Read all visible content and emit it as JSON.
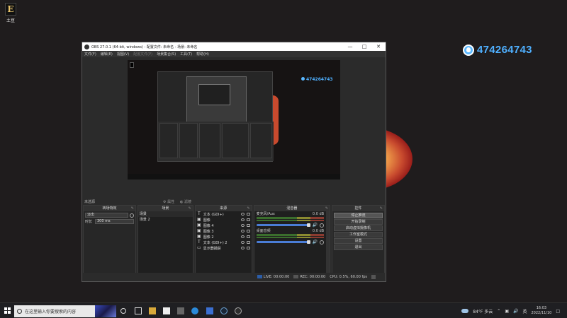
{
  "desktop": {
    "icon_label": "土豆",
    "qq_number": "474264743"
  },
  "obs": {
    "title": "OBS 27.0.1 (64-bit, windows) - 配置文件: 未命名 - 场景: 未命名",
    "menu": [
      "文件(F)",
      "编辑(E)",
      "视图(V)",
      "配置文件(P)",
      "场景集合(S)",
      "工具(T)",
      "帮助(H)"
    ],
    "canvas_qq": "474264743",
    "status_source": "未选源",
    "tools": [
      "属性",
      "滤镜"
    ],
    "docks": {
      "transition": {
        "title": "转场特效",
        "selected": "淡出",
        "duration_label": "时长",
        "duration_value": "300 ms"
      },
      "scenes": {
        "title": "场景",
        "items": [
          "场景",
          "场景 2"
        ]
      },
      "sources": {
        "title": "来源",
        "items": [
          {
            "icon": "text-icon",
            "name": "文本 (GDI+)"
          },
          {
            "icon": "image-icon",
            "name": "图像"
          },
          {
            "icon": "image-icon",
            "name": "图像 4"
          },
          {
            "icon": "image-icon",
            "name": "图像 3"
          },
          {
            "icon": "image-icon",
            "name": "图像 2"
          },
          {
            "icon": "text-icon",
            "name": "文本 (GDI+) 2"
          },
          {
            "icon": "monitor-icon",
            "name": "显示器捕获"
          }
        ]
      },
      "mixer": {
        "title": "混音器",
        "channels": [
          {
            "name": "麦克风/Aux",
            "db": "0.0 dB"
          },
          {
            "name": "桌面音频",
            "db": "0.0 dB"
          }
        ]
      },
      "controls": {
        "title": "控件",
        "buttons": [
          "停止推流",
          "开始录制",
          "启动虚拟摄像机",
          "工作室模式",
          "设置",
          "退出"
        ]
      }
    },
    "statusbar": {
      "live": "LIVE: 00:00:00",
      "rec": "REC: 00:00:00",
      "cpu": "CPU: 0.5%, 60.00 fps"
    }
  },
  "taskbar": {
    "search_placeholder": "在这里输入你要搜索的内容",
    "weather": "84°F 多云",
    "ime": "英",
    "time": "16:03",
    "date": "2022/11/10"
  }
}
